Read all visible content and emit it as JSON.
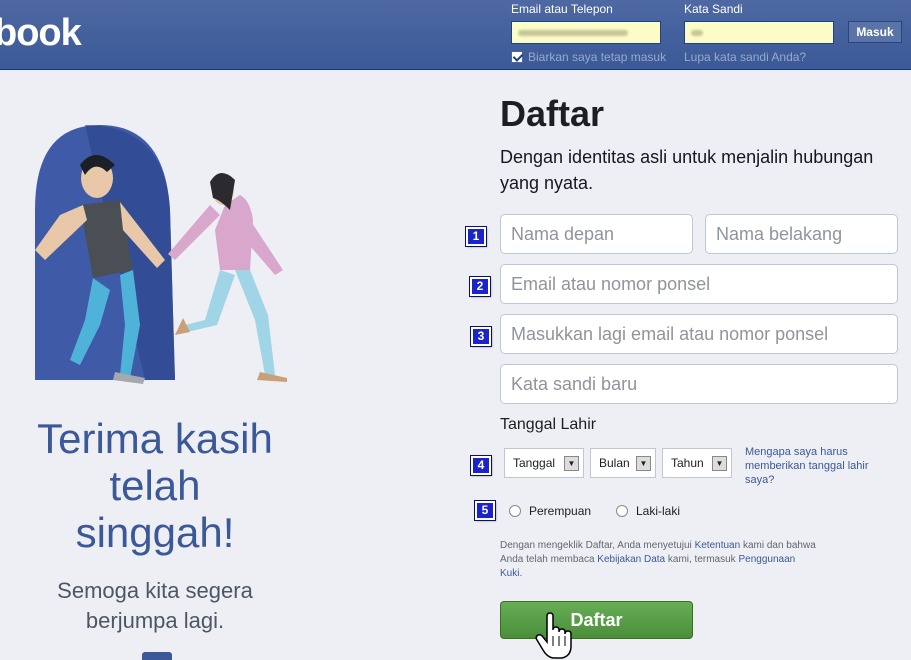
{
  "header": {
    "logo": "book",
    "email_label": "Email atau Telepon",
    "password_label": "Kata Sandi",
    "login_button": "Masuk",
    "keep_logged_in": "Biarkan saya tetap masuk",
    "forgot_password": "Lupa kata sandi Anda?"
  },
  "left": {
    "thanks_line1": "Terima kasih",
    "thanks_line2": "telah",
    "thanks_line3": "singgah!",
    "see_you_line1": "Semoga kita segera",
    "see_you_line2": "berjumpa lagi."
  },
  "signup": {
    "title": "Daftar",
    "subtitle": "Dengan identitas asli untuk menjalin hubungan yang nyata.",
    "first_name_placeholder": "Nama depan",
    "last_name_placeholder": "Nama belakang",
    "email_placeholder": "Email atau nomor ponsel",
    "email_confirm_placeholder": "Masukkan lagi email atau nomor ponsel",
    "password_placeholder": "Kata sandi baru",
    "birthday_label": "Tanggal Lahir",
    "day_select": "Tanggal",
    "month_select": "Bulan",
    "year_select": "Tahun",
    "why_birthday": "Mengapa saya harus memberikan tanggal lahir saya?",
    "female": "Perempuan",
    "male": "Laki-laki",
    "terms_1": "Dengan mengeklik Daftar, Anda menyetujui ",
    "terms_link1": "Ketentuan",
    "terms_2": " kami dan bahwa Anda telah membaca ",
    "terms_link2": "Kebijakan Data",
    "terms_3": " kami, termasuk ",
    "terms_link3": "Penggunaan Kuki",
    "terms_4": ".",
    "submit": "Daftar"
  },
  "badges": [
    "1",
    "2",
    "3",
    "4",
    "5"
  ],
  "colors": {
    "header_blue": "#3b5998",
    "button_green": "#4a8e3a",
    "badge_blue": "#1a23cc"
  }
}
